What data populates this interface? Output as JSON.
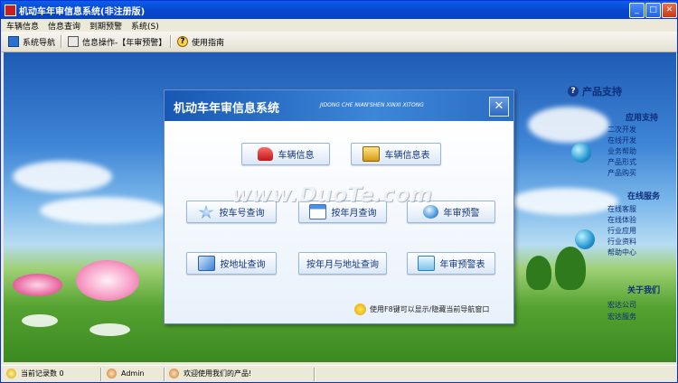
{
  "window": {
    "title": "机动车年审信息系统(非注册版)",
    "minimize": "_",
    "maximize": "□",
    "close": "✕"
  },
  "menu": [
    "车辆信息",
    "信息查询",
    "到期预警",
    "系统(S)"
  ],
  "toolbar": [
    "系统导航",
    "信息操作-【年审预警】",
    "使用指南"
  ],
  "dialog": {
    "title": "机动车年审信息系统",
    "subtitle": "JIDONG CHE NIAN'SHEN XINXI XITONG",
    "close": "✕",
    "buttons": [
      "车辆信息",
      "车辆信息表",
      "按车号查询",
      "按年月查询",
      "年审预警",
      "按地址查询",
      "按年月与地址查询",
      "年审预警表"
    ],
    "hint": "使用F8键可以显示/隐藏当前导航窗口"
  },
  "watermark": "www.DuoTe.com",
  "product_support": {
    "title": "产品支持",
    "sections": [
      {
        "heading": "应用支持",
        "items": [
          "二次开发",
          "在线开发",
          "业务帮助",
          "产品形式",
          "产品购买"
        ]
      },
      {
        "heading": "在线服务",
        "items": [
          "在线客服",
          "在线体验",
          "行业应用",
          "行业资料",
          "帮助中心"
        ]
      },
      {
        "heading": "关于我们",
        "items": [
          "宏达公司",
          "宏达服务"
        ]
      }
    ]
  },
  "status": {
    "records": "当前记录数 0",
    "user": "Admin",
    "welcome": "欢迎使用我们的产品!"
  },
  "colors": {
    "title_bar": "#0748d0",
    "dialog_header": "#1858b4",
    "link": "#0b2e7a"
  }
}
